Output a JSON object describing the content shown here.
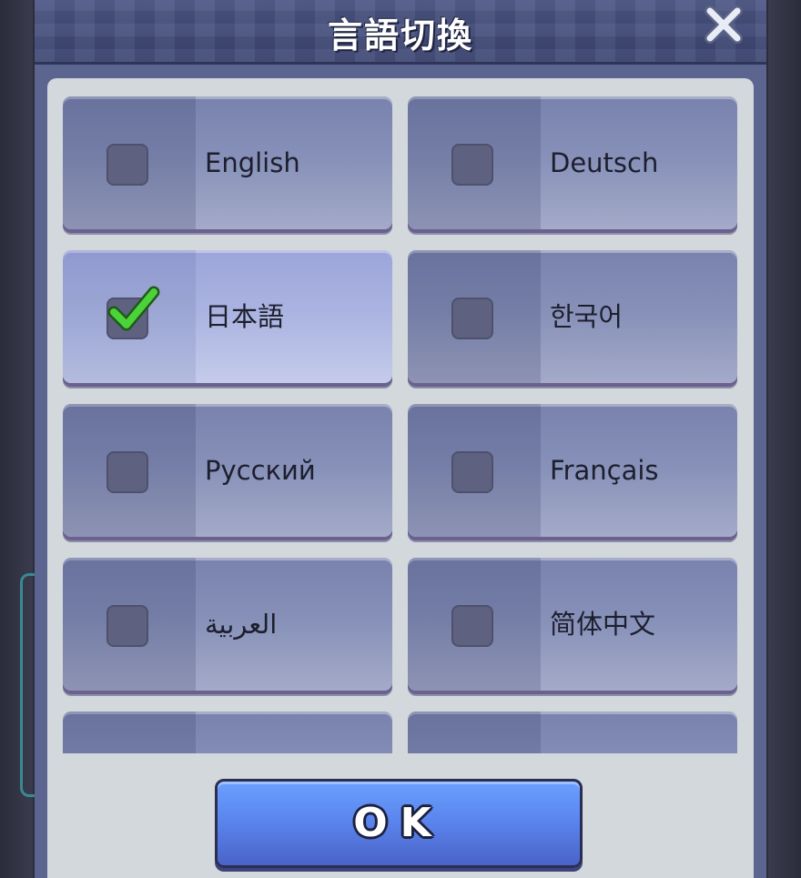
{
  "dialog": {
    "title": "言語切換",
    "close_icon": "close-x-icon"
  },
  "languages": [
    {
      "label": "English",
      "selected": false
    },
    {
      "label": "Deutsch",
      "selected": false
    },
    {
      "label": "日本語",
      "selected": true
    },
    {
      "label": "한국어",
      "selected": false
    },
    {
      "label": "Русский",
      "selected": false
    },
    {
      "label": "Français",
      "selected": false
    },
    {
      "label": "العربية",
      "selected": false
    },
    {
      "label": "简体中文",
      "selected": false
    },
    {
      "label": "",
      "selected": false
    },
    {
      "label": "",
      "selected": false
    }
  ],
  "ok_button": {
    "label": "OK"
  },
  "colors": {
    "panel": "#d3d8dd",
    "button": "#8690b8",
    "selected_button": "#aab3e0",
    "check_green": "#4cd23a",
    "ok_blue": "#5b86ee"
  }
}
